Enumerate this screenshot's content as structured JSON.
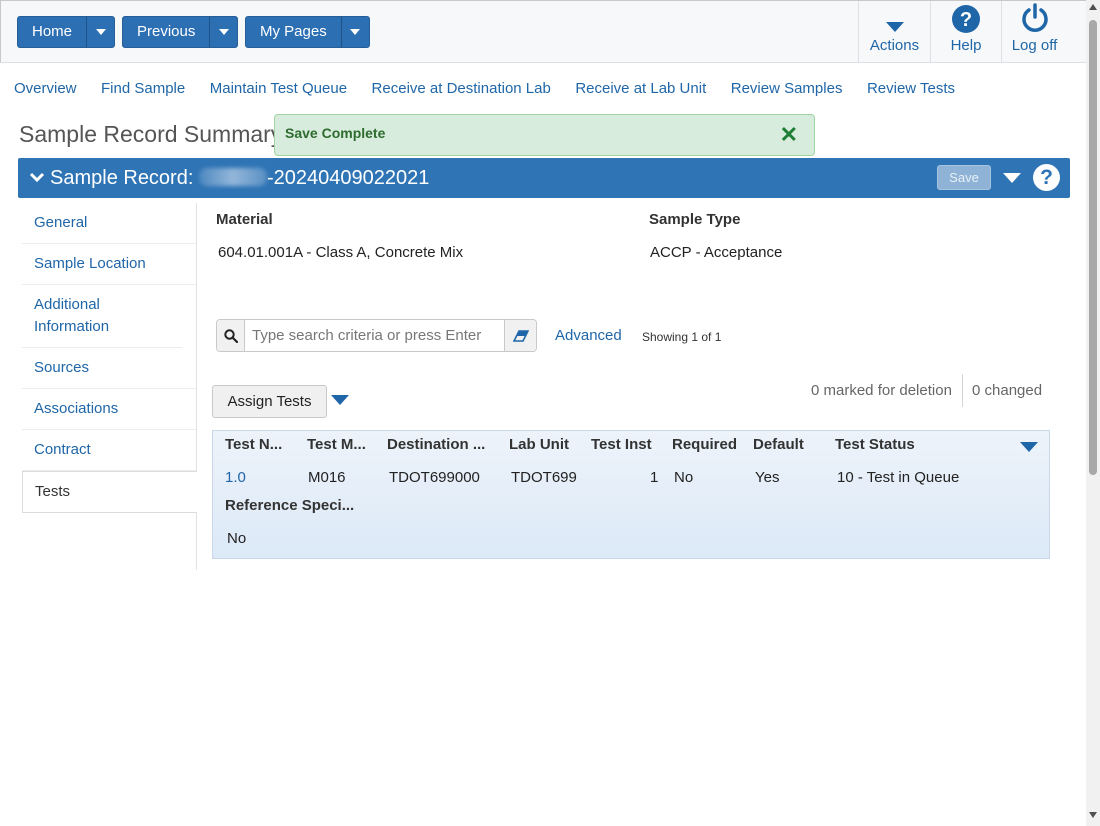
{
  "toolbar": {
    "home": "Home",
    "previous": "Previous",
    "my_pages": "My Pages",
    "actions": "Actions",
    "help": "Help",
    "logoff": "Log off"
  },
  "nav_links": [
    "Overview",
    "Find Sample",
    "Maintain Test Queue",
    "Receive at Destination Lab",
    "Receive at Lab Unit",
    "Review Samples",
    "Review Tests"
  ],
  "page": {
    "title": "Sample Record Summary",
    "toast": "Save Complete",
    "toast_close": "✕"
  },
  "record": {
    "label": "Sample Record:",
    "id_suffix": "-20240409022021",
    "save": "Save",
    "help_glyph": "?"
  },
  "sidenav": [
    "General",
    "Sample Location",
    "Additional Information",
    "Sources",
    "Associations",
    "Contract",
    "Tests"
  ],
  "fields": {
    "material_label": "Material",
    "material_value": "604.01.001A - Class A, Concrete Mix",
    "sample_type_label": "Sample Type",
    "sample_type_value": "ACCP - Acceptance"
  },
  "search": {
    "placeholder": "Type search criteria or press Enter",
    "advanced": "Advanced",
    "showing": "Showing 1 of 1"
  },
  "tests": {
    "assign_button": "Assign Tests",
    "marked_for_deletion": "0 marked for deletion",
    "changed": "0 changed",
    "headers": [
      "Test N...",
      "Test M...",
      "Destination ...",
      "Lab Unit",
      "Test Inst",
      "Required",
      "Default",
      "Test Status",
      "Reference Speci..."
    ],
    "row": {
      "test_no": "1.0",
      "test_method": "M016",
      "destination": "TDOT699000",
      "lab_unit": "TDOT699",
      "test_inst": "1",
      "required": "No",
      "default": "Yes",
      "test_status": "10 - Test in Queue",
      "reference_spec": "No"
    }
  },
  "colors": {
    "primary": "#2f74b5",
    "link": "#1f66a8",
    "success_bg": "#d7ecdc",
    "success_text": "#2e6b2e"
  }
}
